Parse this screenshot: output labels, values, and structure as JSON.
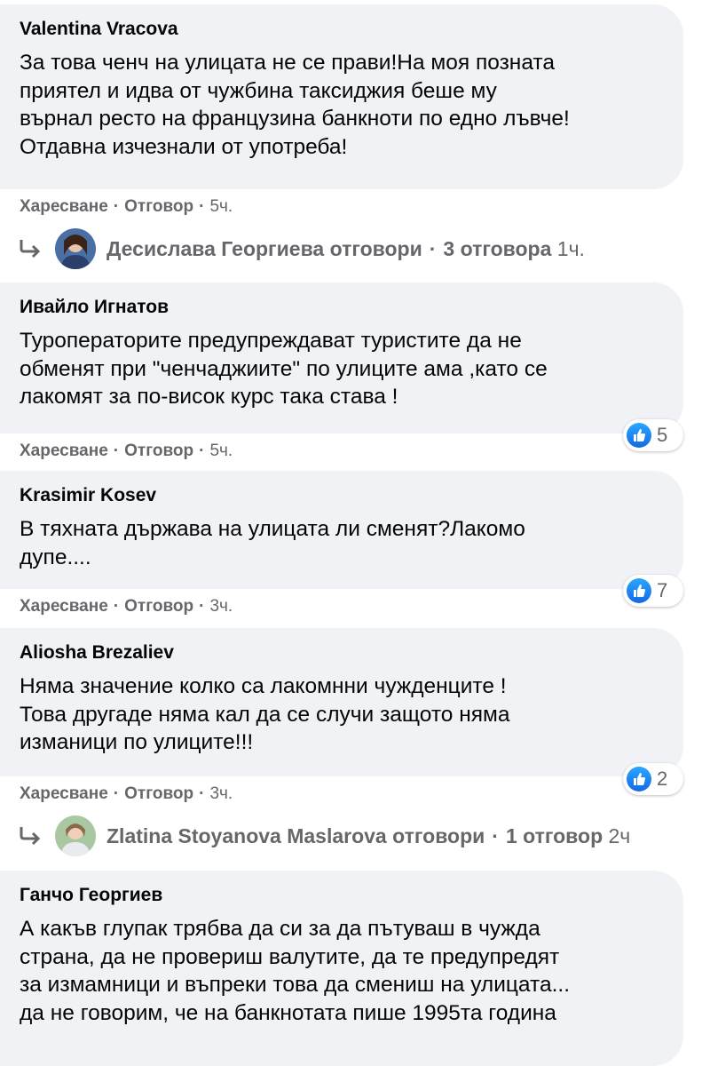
{
  "comments": [
    {
      "author": "Valentina Vracova",
      "lines": [
        "За това ченч на улицата не се прави!На моя позната",
        "приятел и идва от чужбина таксиджия беше му",
        "върнал ресто на французина банкноти по едно лъвче!",
        "Отдавна изчезнали от употреба!"
      ],
      "like": "Харесване",
      "reply": "Отговор",
      "time": "5ч.",
      "reactions": null
    },
    {
      "author": "Ивайло Игнатов",
      "lines": [
        "Туроператорите предупреждават туристите да не",
        "обменят при \"ченчаджиите\" по улиците ама ,като се",
        "лакомят за по-висок курс така става !"
      ],
      "like": "Харесване",
      "reply": "Отговор",
      "time": "5ч.",
      "reactions": "5"
    },
    {
      "author": "Krasimir Kosev",
      "lines": [
        "В тяхната държава на улицата ли сменят?Лакомо",
        "дупе...."
      ],
      "like": "Харесване",
      "reply": "Отговор",
      "time": "3ч.",
      "reactions": "7"
    },
    {
      "author": "Aliosha Brezaliev",
      "lines": [
        "Няма значение колко са лакомнни чужденците !",
        "Това другаде няма кал да се случи защото няма",
        "изманици по улиците!!!"
      ],
      "like": "Харесване",
      "reply": "Отговор",
      "time": "3ч.",
      "reactions": "2"
    },
    {
      "author": "Ганчо Георгиев",
      "lines": [
        "А какъв глупак трябва да си за да пътуваш в чужда",
        "страна, да не провериш валутите, да те предупредят",
        "за измамници и въпреки това да смениш на улицата...",
        "да не говорим, че на банкнотата пише 1995та година"
      ]
    }
  ],
  "replies": [
    {
      "name": "Десислава Георгиева",
      "verb": "отговори",
      "count": "3 отговора",
      "time": "1ч."
    },
    {
      "name": "Zlatina Stoyanova Maslarova",
      "verb": "отговори",
      "count": "1 отговор",
      "time": "2ч"
    }
  ],
  "icons": {
    "reply_arrow": "reply-arrow-icon",
    "like": "like-thumb-icon"
  },
  "colors": {
    "bubble": "#f0f2f5",
    "secondary_text": "#65676b",
    "like_blue": "#1877f2"
  }
}
